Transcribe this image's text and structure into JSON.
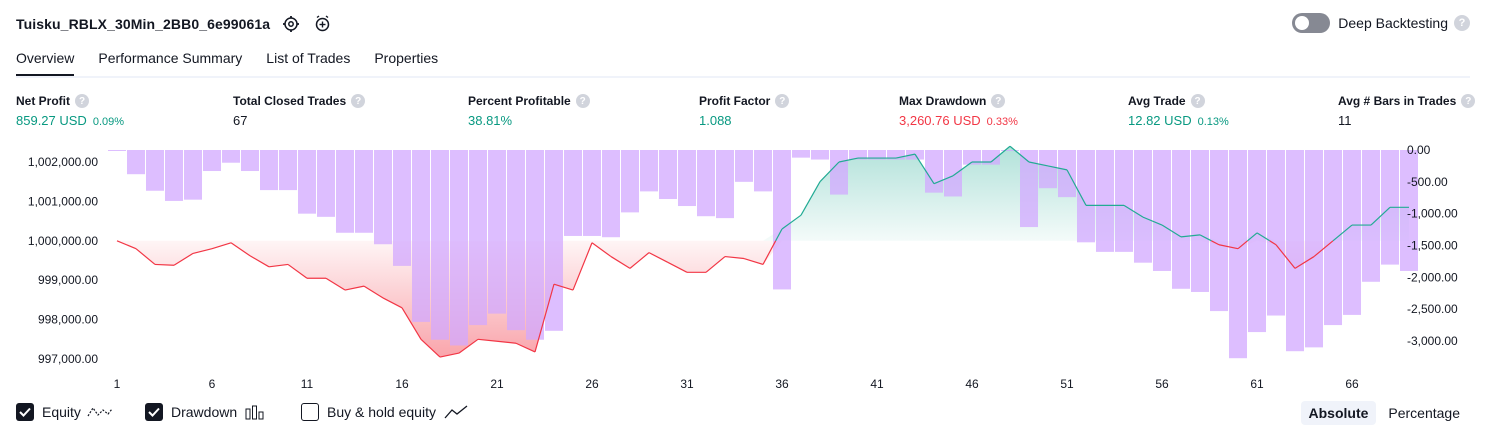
{
  "header": {
    "strategy_name": "Tuisku_RBLX_30Min_2BB0_6e99061a",
    "deep_backtesting_label": "Deep Backtesting",
    "help_glyph": "?"
  },
  "tabs": [
    {
      "label": "Overview",
      "active": true
    },
    {
      "label": "Performance Summary",
      "active": false
    },
    {
      "label": "List of Trades",
      "active": false
    },
    {
      "label": "Properties",
      "active": false
    }
  ],
  "stats": {
    "net_profit": {
      "label": "Net Profit",
      "value": "859.27 USD",
      "pct": "0.09%"
    },
    "total_closed_trades": {
      "label": "Total Closed Trades",
      "value": "67"
    },
    "percent_profitable": {
      "label": "Percent Profitable",
      "value": "38.81%"
    },
    "profit_factor": {
      "label": "Profit Factor",
      "value": "1.088"
    },
    "max_drawdown": {
      "label": "Max Drawdown",
      "value": "3,260.76 USD",
      "pct": "0.33%"
    },
    "avg_trade": {
      "label": "Avg Trade",
      "value": "12.82 USD",
      "pct": "0.13%"
    },
    "avg_bars": {
      "label": "Avg # Bars in Trades",
      "value": "11"
    }
  },
  "legend": {
    "equity": "Equity",
    "drawdown": "Drawdown",
    "buy_hold": "Buy & hold equity",
    "equity_checked": true,
    "drawdown_checked": true,
    "buy_hold_checked": false
  },
  "view_toggle": {
    "absolute": "Absolute",
    "percentage": "Percentage",
    "selected": "Absolute"
  },
  "colors": {
    "positive": "#089981",
    "negative": "#f23645",
    "drawdown_bar": "#d1a8ff",
    "equity_up_line": "#22ab94",
    "equity_down_line": "#f23645"
  },
  "chart_data": {
    "type": "line",
    "baseline": 1000000,
    "x_ticks": [
      "1",
      "6",
      "11",
      "16",
      "21",
      "26",
      "31",
      "36",
      "41",
      "46",
      "51",
      "56",
      "61",
      "66"
    ],
    "y_left_ticks": [
      "1,002,000.00",
      "1,001,000.00",
      "1,000,000.00",
      "999,000.00",
      "998,000.00",
      "997,000.00"
    ],
    "y_left_range": [
      996750,
      1002350
    ],
    "y_right_ticks": [
      "0.00",
      "-500.00",
      "-1,000.00",
      "-1,500.00",
      "-2,000.00",
      "-2,500.00",
      "-3,000.00"
    ],
    "y_right_range": [
      -3350,
      0
    ],
    "series": [
      {
        "name": "Equity",
        "x": [
          1,
          2,
          3,
          4,
          5,
          6,
          7,
          8,
          9,
          10,
          11,
          12,
          13,
          14,
          15,
          16,
          17,
          18,
          19,
          20,
          21,
          22,
          23,
          24,
          25,
          26,
          27,
          28,
          29,
          30,
          31,
          32,
          33,
          34,
          35,
          36,
          37,
          38,
          39,
          40,
          41,
          42,
          43,
          44,
          45,
          46,
          47,
          48,
          49,
          50,
          51,
          52,
          53,
          54,
          55,
          56,
          57,
          58,
          59,
          60,
          61,
          62,
          63,
          64,
          65,
          66,
          67,
          68,
          69
        ],
        "values": [
          1000000,
          999800,
          999400,
          999380,
          999680,
          999800,
          999950,
          999620,
          999340,
          999400,
          999050,
          999050,
          998750,
          998850,
          998550,
          998300,
          997500,
          997050,
          997150,
          997500,
          997450,
          997400,
          997180,
          998900,
          998750,
          999950,
          999600,
          999300,
          999700,
          999450,
          999200,
          999200,
          999600,
          999550,
          999400,
          1000300,
          1000650,
          1001500,
          1002000,
          1002100,
          1002100,
          1002100,
          1002200,
          1001450,
          1001650,
          1002000,
          1002000,
          1002400,
          1002000,
          1001900,
          1001800,
          1000900,
          1000900,
          1000900,
          1000600,
          1000400,
          1000100,
          1000150,
          999900,
          999800,
          1000200,
          999900,
          999300,
          999600,
          1000000,
          1000400,
          1000400,
          1000850,
          1000850
        ]
      },
      {
        "name": "Drawdown",
        "x": [
          1,
          2,
          3,
          4,
          5,
          6,
          7,
          8,
          9,
          10,
          11,
          12,
          13,
          14,
          15,
          16,
          17,
          18,
          19,
          20,
          21,
          22,
          23,
          24,
          25,
          26,
          27,
          28,
          29,
          30,
          31,
          32,
          33,
          34,
          35,
          36,
          37,
          38,
          39,
          40,
          41,
          42,
          43,
          44,
          45,
          46,
          47,
          48,
          49,
          50,
          51,
          52,
          53,
          54,
          55,
          56,
          57,
          58,
          59,
          60,
          61,
          62,
          63,
          64,
          65,
          66,
          67,
          68,
          69
        ],
        "values": [
          0,
          -380,
          -640,
          -800,
          -780,
          -330,
          -200,
          -330,
          -630,
          -630,
          -1000,
          -1050,
          -1300,
          -1300,
          -1480,
          -1820,
          -2700,
          -2980,
          -3070,
          -2750,
          -2570,
          -2830,
          -2980,
          -2840,
          -1350,
          -1350,
          -1370,
          -980,
          -650,
          -770,
          -880,
          -1040,
          -1070,
          -500,
          -650,
          -2190,
          -120,
          -150,
          -700,
          -150,
          -150,
          -150,
          -150,
          -670,
          -730,
          -230,
          -230,
          0,
          -1210,
          -600,
          -740,
          -1450,
          -1600,
          -1600,
          -1770,
          -1900,
          -2180,
          -2230,
          -2530,
          -3270,
          -2860,
          -2600,
          -3160,
          -3100,
          -2750,
          -2590,
          -2070,
          -1800,
          -1900
        ]
      }
    ]
  }
}
